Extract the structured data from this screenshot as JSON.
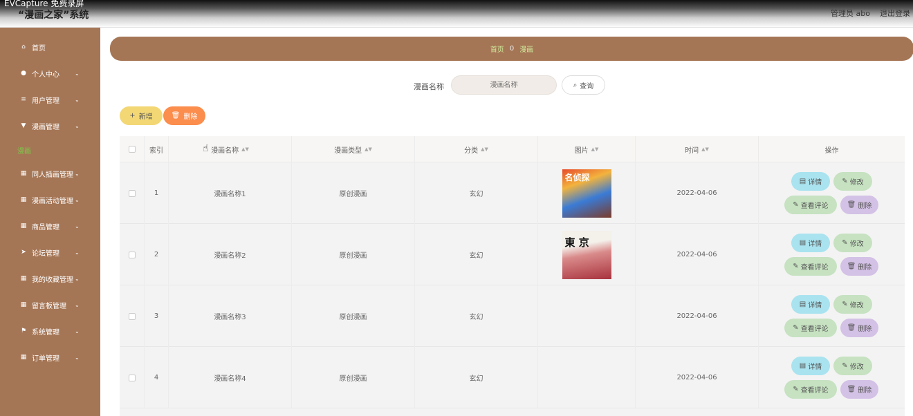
{
  "watermark": "EVCapture 免费录屏",
  "header": {
    "title": "“漫画之家”系统",
    "user": "管理员 abo",
    "logout": "退出登录"
  },
  "sidebar": {
    "items": [
      {
        "label": "首页",
        "icon": "home-icon",
        "glyph": "⌂",
        "chevron": false
      },
      {
        "label": "个人中心",
        "icon": "user-icon",
        "glyph": "●",
        "chevron": true
      },
      {
        "label": "用户管理",
        "icon": "sliders-icon",
        "glyph": "≡",
        "chevron": true
      },
      {
        "label": "漫画管理",
        "icon": "filter-icon",
        "glyph": "▼",
        "chevron": true
      },
      {
        "label": "同人插画管理",
        "icon": "grid-icon",
        "glyph": "▦",
        "chevron": true
      },
      {
        "label": "漫画活动管理",
        "icon": "grid-icon",
        "glyph": "▦",
        "chevron": true
      },
      {
        "label": "商品管理",
        "icon": "grid-icon",
        "glyph": "▦",
        "chevron": true
      },
      {
        "label": "论坛管理",
        "icon": "send-icon",
        "glyph": "➤",
        "chevron": true
      },
      {
        "label": "我的收藏管理",
        "icon": "grid-icon",
        "glyph": "▦",
        "chevron": true
      },
      {
        "label": "留言板管理",
        "icon": "grid-icon",
        "glyph": "▦",
        "chevron": true
      },
      {
        "label": "系统管理",
        "icon": "flag-icon",
        "glyph": "⚑",
        "chevron": true
      },
      {
        "label": "订单管理",
        "icon": "grid-icon",
        "glyph": "▦",
        "chevron": true
      }
    ],
    "active_sub": "漫画"
  },
  "breadcrumb": {
    "home": "首页",
    "sep": "0",
    "current": "漫画"
  },
  "search": {
    "label": "漫画名称",
    "placeholder": "漫画名称",
    "button": "查询"
  },
  "toolbar": {
    "add": "新增",
    "delete": "删除"
  },
  "table": {
    "headers": [
      "索引",
      "漫画名称",
      "漫画类型",
      "分类",
      "图片",
      "时间",
      "操作"
    ],
    "rows": [
      {
        "index": "1",
        "name": "漫画名称1",
        "type": "原创漫画",
        "category": "玄幻",
        "image_text": "名侦探",
        "time": "2022-04-06"
      },
      {
        "index": "2",
        "name": "漫画名称2",
        "type": "原创漫画",
        "category": "玄幻",
        "image_text": "東 京",
        "time": "2022-04-06"
      },
      {
        "index": "3",
        "name": "漫画名称3",
        "type": "原创漫画",
        "category": "玄幻",
        "image_text": "",
        "time": "2022-04-06"
      },
      {
        "index": "4",
        "name": "漫画名称4",
        "type": "原创漫画",
        "category": "玄幻",
        "image_text": "",
        "time": "2022-04-06"
      }
    ],
    "actions": {
      "detail": "详情",
      "edit": "修改",
      "comment": "查看评论",
      "delete": "删除"
    }
  },
  "colors": {
    "sidebar": "#a57656",
    "accent": "#7dc84a",
    "add": "#f2d774",
    "delete": "#fb8d4d"
  }
}
